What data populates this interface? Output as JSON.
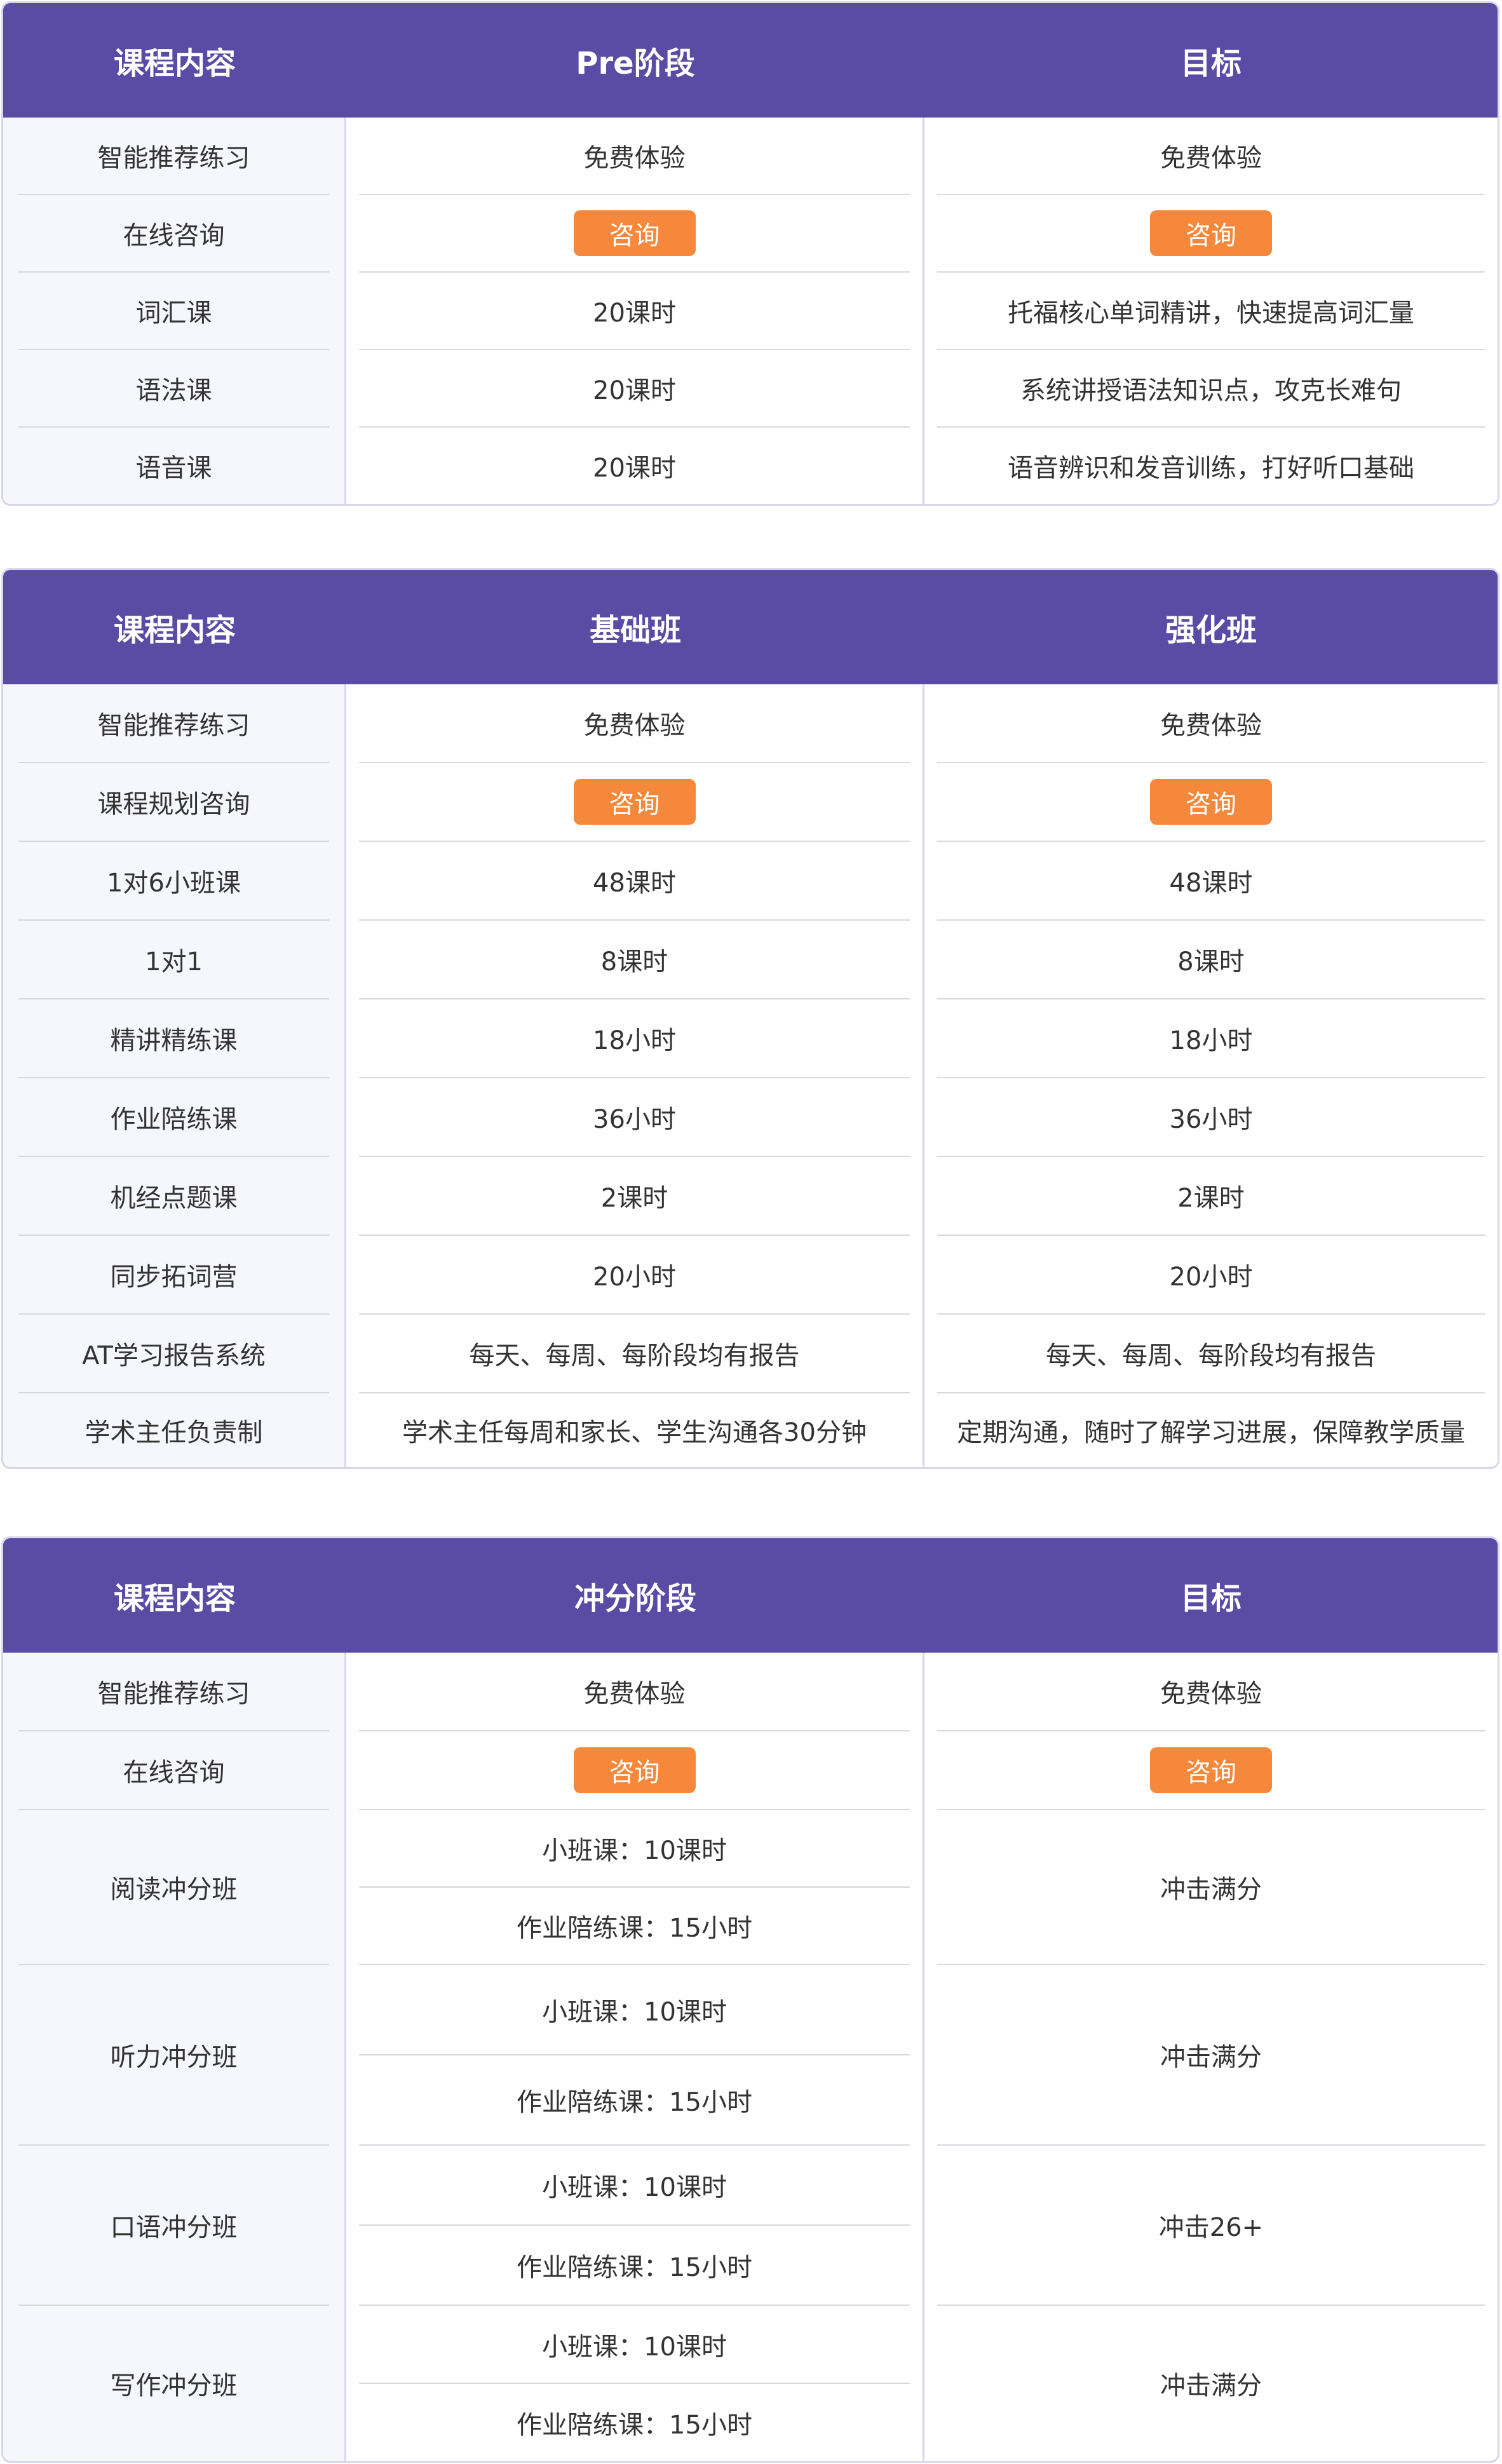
{
  "table1": {
    "headers": [
      "课程内容",
      "Pre阶段",
      "目标"
    ],
    "rows": [
      {
        "label": "智能推荐练习",
        "a": "免费体验",
        "b": "免费体验"
      },
      {
        "label": "在线咨询",
        "a": "咨询",
        "b": "咨询"
      },
      {
        "label": "词汇课",
        "a": "20课时",
        "b": "托福核心单词精讲，快速提高词汇量"
      },
      {
        "label": "语法课",
        "a": "20课时",
        "b": "系统讲授语法知识点，攻克长难句"
      },
      {
        "label": "语音课",
        "a": "20课时",
        "b": "语音辨识和发音训练，打好听口基础"
      }
    ]
  },
  "table2": {
    "headers": [
      "课程内容",
      "基础班",
      "强化班"
    ],
    "rows": [
      {
        "label": "智能推荐练习",
        "a": "免费体验",
        "b": "免费体验"
      },
      {
        "label": "课程规划咨询",
        "a": "咨询",
        "b": "咨询"
      },
      {
        "label": "1对6小班课",
        "a": "48课时",
        "b": "48课时"
      },
      {
        "label": "1对1",
        "a": "8课时",
        "b": "8课时"
      },
      {
        "label": "精讲精练课",
        "a": "18小时",
        "b": "18小时"
      },
      {
        "label": "作业陪练课",
        "a": "36小时",
        "b": "36小时"
      },
      {
        "label": "机经点题课",
        "a": "2课时",
        "b": "2课时"
      },
      {
        "label": "同步拓词营",
        "a": "20小时",
        "b": "20小时"
      },
      {
        "label": "AT学习报告系统",
        "a": "每天、每周、每阶段均有报告",
        "b": "每天、每周、每阶段均有报告"
      },
      {
        "label": "学术主任负责制",
        "a": "学术主任每周和家长、学生沟通各30分钟",
        "b": "定期沟通，随时了解学习进展，保障教学质量"
      }
    ]
  },
  "table3": {
    "headers": [
      "课程内容",
      "冲分阶段",
      "目标"
    ],
    "rows": [
      {
        "label": "智能推荐练习",
        "a": "免费体验",
        "b": "免费体验"
      },
      {
        "label": "在线咨询",
        "a": "咨询",
        "b": "咨询"
      }
    ],
    "groups": [
      {
        "label": "阅读冲分班",
        "a1": "小班课：10课时",
        "a2": "作业陪练课：15小时",
        "b": "冲击满分"
      },
      {
        "label": "听力冲分班",
        "a1": "小班课：10课时",
        "a2": "作业陪练课：15小时",
        "b": "冲击满分"
      },
      {
        "label": "口语冲分班",
        "a1": "小班课：10课时",
        "a2": "作业陪练课：15小时",
        "b": "冲击26+"
      },
      {
        "label": "写作冲分班",
        "a1": "小班课：10课时",
        "a2": "作业陪练课：15小时",
        "b": "冲击满分"
      }
    ]
  },
  "colors": {
    "header_bg": "#5a4ba5",
    "consult_button": "#f5883b",
    "label_column_bg": "#f6f6fd"
  }
}
